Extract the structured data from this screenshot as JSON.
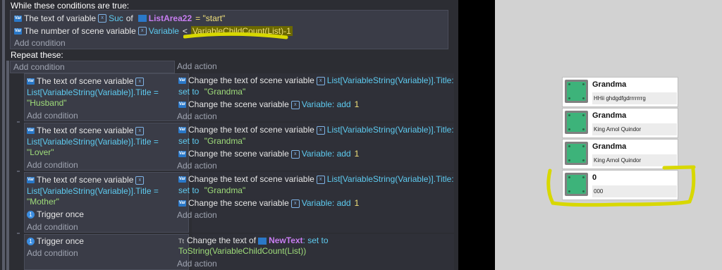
{
  "while_block": {
    "title": "While these conditions are true:",
    "cond1": {
      "text1": "The text of variable",
      "var": "Suc",
      "of": "of",
      "object": "ListArea22",
      "eq": "= \"start\""
    },
    "cond2": {
      "text1": "The number of scene variable",
      "var": "Variable",
      "lt": "<",
      "expr": "VariableChildCount(List)-1"
    },
    "add_condition": "Add condition"
  },
  "repeat_label": "Repeat these:",
  "top_add_condition": "Add condition",
  "top_add_action": "Add action",
  "events": [
    {
      "cond_line1": "The text of scene variable",
      "cond_line2": "List[VariableString(Variable)].Title =",
      "cond_value": "\"Husband\"",
      "trigger": "",
      "add_condition": "Add condition",
      "act1_a": "Change the text of scene variable",
      "act1_b": "List[VariableString(Variable)].Title:",
      "act1_c": "set to",
      "act1_d": "\"Grandma\"",
      "act2_a": "Change the scene variable",
      "act2_b": "Variable",
      "act2_c": ": add",
      "act2_d": "1",
      "add_action": "Add action"
    },
    {
      "cond_line1": "The text of scene variable",
      "cond_line2": "List[VariableString(Variable)].Title =",
      "cond_value": "\"Lover\"",
      "trigger": "",
      "add_condition": "Add condition",
      "act1_a": "Change the text of scene variable",
      "act1_b": "List[VariableString(Variable)].Title:",
      "act1_c": "set to",
      "act1_d": "\"Grandma\"",
      "act2_a": "Change the scene variable",
      "act2_b": "Variable",
      "act2_c": ": add",
      "act2_d": "1",
      "add_action": "Add action"
    },
    {
      "cond_line1": "The text of scene variable",
      "cond_line2": "List[VariableString(Variable)].Title =",
      "cond_value": "\"Mother\"",
      "trigger": "Trigger once",
      "add_condition": "Add condition",
      "act1_a": "Change the text of scene variable",
      "act1_b": "List[VariableString(Variable)].Title:",
      "act1_c": "set to",
      "act1_d": "\"Grandma\"",
      "act2_a": "Change the scene variable",
      "act2_b": "Variable",
      "act2_c": ": add",
      "act2_d": "1",
      "add_action": "Add action"
    }
  ],
  "last_event": {
    "trigger": "Trigger once",
    "add_condition": "Add condition",
    "act_a": "Change the text of",
    "act_obj": "NewText",
    "act_b": ": set to",
    "act_expr": "ToString(VariableChildCount(List))",
    "add_action": "Add action"
  },
  "preview": {
    "cards": [
      {
        "title": "Grandma",
        "subtitle": "HHii ghdgdfgdrrrrrrrg"
      },
      {
        "title": "Grandma",
        "subtitle": "King Arnol Quindor"
      },
      {
        "title": "Grandma",
        "subtitle": "King Arnol Quindor"
      },
      {
        "title": "0",
        "subtitle": "000"
      }
    ]
  },
  "colors": {
    "highlight": "#d8d800",
    "accent_green": "#3db37a"
  }
}
